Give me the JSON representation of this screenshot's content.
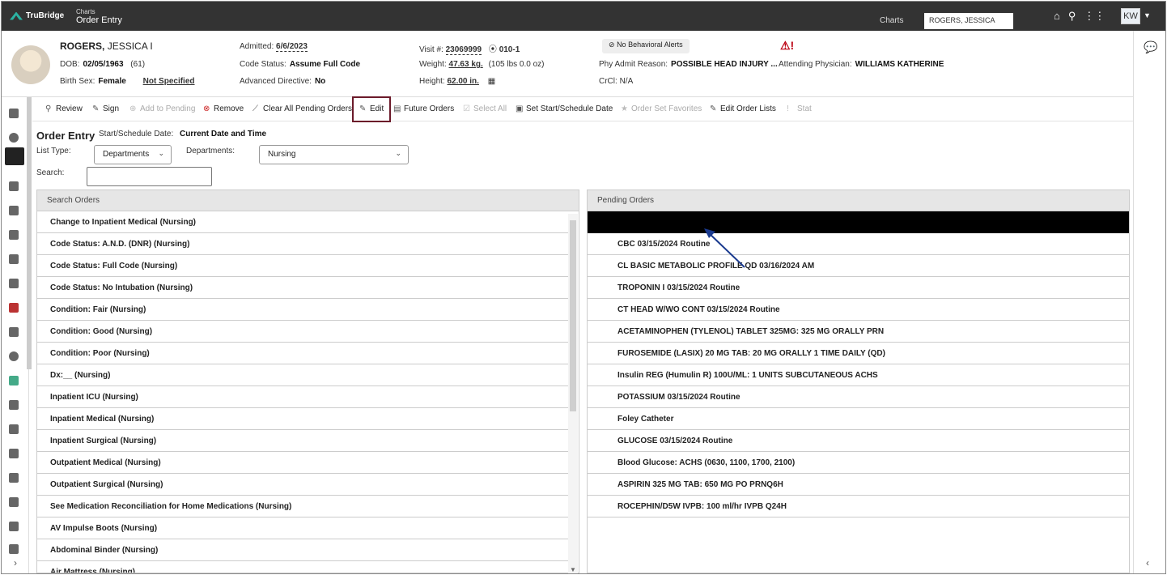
{
  "topbar": {
    "logo_text": "TruBridge",
    "crumb_small": "Charts",
    "crumb_big": "Order Entry",
    "charts_link": "Charts",
    "patient_pill": "ROGERS, JESSICA",
    "user_initials": "KW"
  },
  "patient": {
    "last_name": "ROGERS,",
    "first_name": "JESSICA I",
    "dob_label": "DOB:",
    "dob": "02/05/1963",
    "age": "(61)",
    "birth_sex_label": "Birth Sex:",
    "birth_sex": "Female",
    "birth_sex_extra": "Not Specified",
    "admitted_label": "Admitted:",
    "admitted": "6/6/2023",
    "code_status_label": "Code Status:",
    "code_status": "Assume Full Code",
    "adv_directive_label": "Advanced Directive:",
    "adv_directive": "No",
    "visit_label": "Visit #:",
    "visit": "23069999",
    "room": "010-1",
    "weight_label": "Weight:",
    "weight": "47.63 kg.",
    "weight_extra": "(105 lbs 0.0 oz)",
    "height_label": "Height:",
    "height": "62.00 in.",
    "behavioral_alert": "No Behavioral Alerts",
    "admit_reason_label": "Phy Admit Reason:",
    "admit_reason": "POSSIBLE HEAD INJURY ...",
    "crcl_label": "CrCl:",
    "crcl": "N/A",
    "attending_label": "Attending Physician:",
    "attending": "WILLIAMS KATHERINE"
  },
  "toolbar": {
    "review": "Review",
    "sign": "Sign",
    "add_pending": "Add to Pending",
    "remove": "Remove",
    "clear_all": "Clear All Pending Orders",
    "edit": "Edit",
    "future_orders": "Future Orders",
    "select_all": "Select All",
    "set_start": "Set Start/Schedule Date",
    "favorites": "Order Set Favorites",
    "edit_lists": "Edit Order Lists",
    "stat": "Stat"
  },
  "order_entry": {
    "title": "Order Entry",
    "start_label": "Start/Schedule Date:",
    "start_value": "Current Date and Time",
    "list_type_label": "List Type:",
    "list_type_value": "Departments",
    "departments_label": "Departments:",
    "departments_value": "Nursing",
    "search_label": "Search:"
  },
  "search_orders": {
    "header": "Search Orders",
    "items": [
      "Change to Inpatient Medical (Nursing)",
      "Code Status: A.N.D. (DNR) (Nursing)",
      "Code Status: Full Code (Nursing)",
      "Code Status: No Intubation (Nursing)",
      "Condition: Fair (Nursing)",
      "Condition: Good (Nursing)",
      "Condition: Poor (Nursing)",
      "Dx:__ (Nursing)",
      "Inpatient ICU (Nursing)",
      "Inpatient Medical (Nursing)",
      "Inpatient Surgical (Nursing)",
      "Outpatient Medical (Nursing)",
      "Outpatient Surgical (Nursing)",
      "See Medication Reconciliation for Home Medications (Nursing)",
      "AV Impulse Boots (Nursing)",
      "Abdominal Binder (Nursing)",
      "Air Mattress (Nursing)"
    ]
  },
  "pending_orders": {
    "header": "Pending Orders",
    "items": [
      "",
      "CBC 03/15/2024 Routine",
      "CL BASIC METABOLIC PROFILE QD 03/16/2024 AM",
      "TROPONIN I 03/15/2024 Routine",
      "CT HEAD W/WO CONT 03/15/2024 Routine",
      "ACETAMINOPHEN (TYLENOL) TABLET 325MG: 325 MG ORALLY PRN",
      "FUROSEMIDE (LASIX) 20 MG TAB: 20 MG ORALLY 1 TIME DAILY (QD)",
      "Insulin REG (Humulin R) 100U/ML: 1 UNITS SUBCUTANEOUS ACHS",
      "POTASSIUM 03/15/2024 Routine",
      "Foley Catheter",
      "GLUCOSE 03/15/2024 Routine",
      "Blood Glucose: ACHS (0630, 1100, 1700, 2100)",
      "ASPIRIN 325 MG TAB: 650 MG PO PRNQ6H",
      "ROCEPHIN/D5W IVPB: 100 ml/hr IVPB Q24H"
    ]
  },
  "colors": {
    "topbar": "#333333",
    "accent": "#2bb3a3",
    "edit_highlight": "#6b1a2a",
    "arrow": "#1a3a8f"
  }
}
